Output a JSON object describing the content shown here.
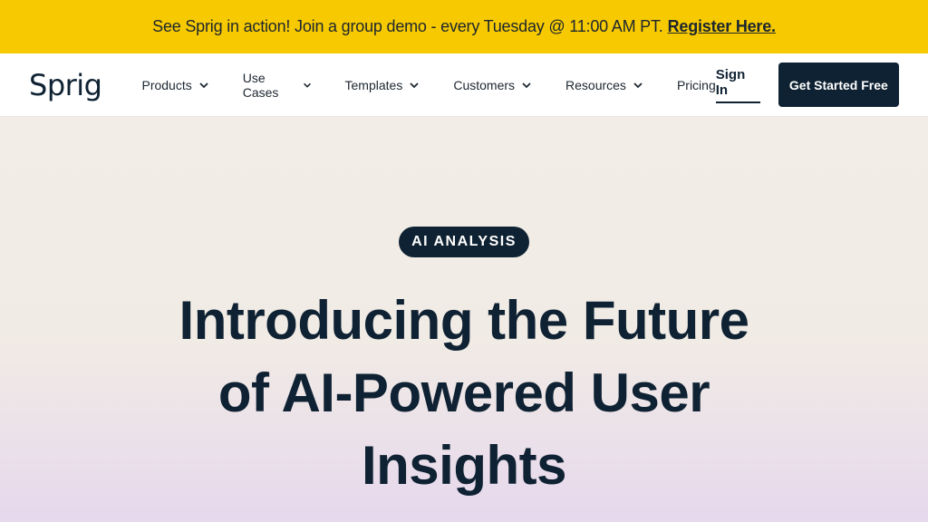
{
  "announcement": {
    "text": "See Sprig in action! Join a group demo - every Tuesday @ 11:00 AM PT.",
    "link": "Register Here."
  },
  "nav": {
    "logo": "Sprig",
    "items": [
      {
        "label": "Products",
        "has_dropdown": true
      },
      {
        "label": "Use Cases",
        "has_dropdown": true
      },
      {
        "label": "Templates",
        "has_dropdown": true
      },
      {
        "label": "Customers",
        "has_dropdown": true
      },
      {
        "label": "Resources",
        "has_dropdown": true
      },
      {
        "label": "Pricing",
        "has_dropdown": false
      }
    ],
    "sign_in": "Sign In",
    "cta": "Get Started Free"
  },
  "hero": {
    "badge": "AI ANALYSIS",
    "headline": "Introducing the Future of AI-Powered User Insights"
  },
  "colors": {
    "announce_bg": "#f6c900",
    "brand_dark": "#0f2233"
  }
}
